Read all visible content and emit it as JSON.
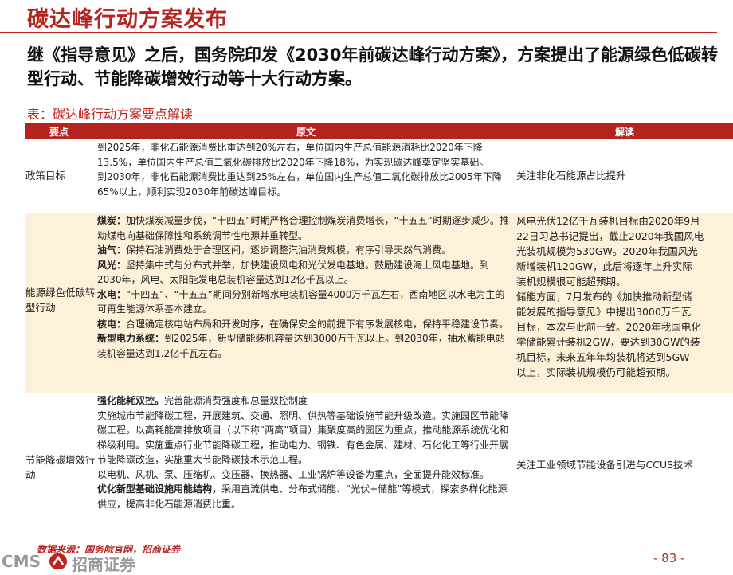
{
  "slide": {
    "title": "碳达峰行动方案发布",
    "lead": "继《指导意见》之后，国务院印发《2030年前碳达峰行动方案》，方案提出了能源绿色低碳转型行动、节能降碳增效行动等十大行动方案。",
    "table_caption": "表：碳达峰行动方案要点解读",
    "source": "数据来源：国务院官网，招商证券",
    "page_number": "- 83 -",
    "logo_text": "CMS",
    "logo_zh": "招商证券"
  },
  "table": {
    "headers": [
      "要点",
      "原文",
      "解读"
    ],
    "rows": [
      {
        "key": "政策目标",
        "paragraphs": [
          {
            "label": "",
            "text": "到2025年，非化石能源消费比重达到20%左右，单位国内生产总值能源消耗比2020年下降13.5%，单位国内生产总值二氧化碳排放比2020年下降18%，为实现碳达峰奠定坚实基础。"
          },
          {
            "label": "",
            "text": "到2030年，非化石能源消费比重达到25%左右，单位国内生产总值二氧化碳排放比2005年下降65%以上，顺利实现2030年前碳达峰目标。"
          }
        ],
        "interpretation": [
          "关注非化石能源占比提升"
        ]
      },
      {
        "key": "能源绿色低碳转型行动",
        "paragraphs": [
          {
            "label": "煤炭：",
            "text": "加快煤炭减量步伐，“十四五”时期严格合理控制煤炭消费增长，“十五五”时期逐步减少。推动煤电向基础保障性和系统调节性电源并重转型。"
          },
          {
            "label": "油气：",
            "text": "保持石油消费处于合理区间，逐步调整汽油消费规模，有序引导天然气消费。"
          },
          {
            "label": "风光：",
            "text": "坚持集中式与分布式并举，加快建设风电和光伏发电基地。鼓励建设海上风电基地。到2030年，风电、太阳能发电总装机容量达到12亿千瓦以上。"
          },
          {
            "label": "水电：",
            "text": "“十四五”、“十五五”期间分别新增水电装机容量4000万千瓦左右，西南地区以水电为主的可再生能源体系基本建立。"
          },
          {
            "label": "核电：",
            "text": "合理确定核电站布局和开发时序，在确保安全的前提下有序发展核电，保持平稳建设节奏。"
          },
          {
            "label": "新型电力系统：",
            "text": "到2025年，新型储能装机容量达到3000万千瓦以上。到2030年，抽水蓄能电站装机容量达到1.2亿千瓦左右。"
          }
        ],
        "interpretation": [
          "风电光伏12亿千瓦装机目标由2020年9月",
          "22日习总书记提出，截止2020年我国风电",
          "光装机规模为530GW。2020年我国风光",
          "新增装机120GW，此后将逐年上升实际",
          "装机规模很可能超预期。",
          "储能方面，7月发布的《加快推动新型储",
          "能发展的指导意见》中提出3000万千瓦",
          "目标，本次与此前一致。2020年我国电化",
          "学储能累计装机2GW，要达到30GW的装",
          "机目标，未来五年年均装机将达到5GW",
          "以上，实际装机规模仍可能超预期。"
        ]
      },
      {
        "key": "节能降碳增效行动",
        "paragraphs": [
          {
            "label": "强化能耗双控。",
            "text": "完善能源消费强度和总量双控制度"
          },
          {
            "label": "",
            "text": "实施城市节能降碳工程，开展建筑、交通、照明、供热等基础设施节能升级改造。实施园区节能降碳工程，以高耗能高排放项目（以下称“两高”项目）集聚度高的园区为重点，推动能源系统优化和梯级利用。实施重点行业节能降碳工程，推动电力、钢铁、有色金属、建材、石化化工等行业开展节能降碳改造，实施重大节能降碳技术示范工程。"
          },
          {
            "label": "",
            "text": "以电机、风机、泵、压缩机、变压器、换热器、工业锅炉等设备为重点，全面提升能效标准。"
          },
          {
            "label": "优化新型基础设施用能结构，",
            "text": "采用直流供电、分布式储能、“光伏+储能”等模式，探索多样化能源供应，提高非化石能源消费比重。"
          }
        ],
        "interpretation": [
          "关注工业领域节能设备引进与CCUS技术"
        ]
      }
    ]
  }
}
